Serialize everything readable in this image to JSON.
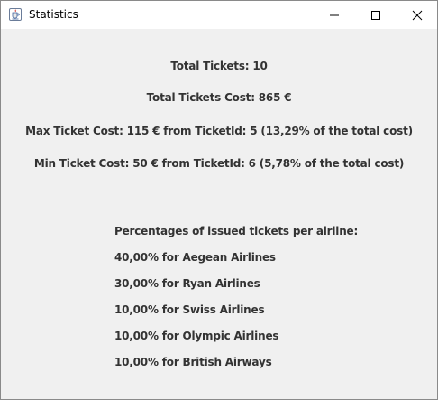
{
  "window": {
    "title": "Statistics",
    "app_icon": "java-cup-icon"
  },
  "stats": {
    "total_tickets": "Total Tickets: 10",
    "total_cost": "Total Tickets Cost: 865 €",
    "max_cost": "Max Ticket Cost: 115 € from TicketId: 5 (13,29% of the total cost)",
    "min_cost": "Min Ticket Cost: 50 € from TicketId: 6 (5,78% of the total cost)"
  },
  "airlines": {
    "heading": "Percentages of issued tickets per airline:",
    "items": [
      "40,00% for Aegean Airlines",
      "30,00% for Ryan Airlines",
      "10,00% for Swiss Airlines",
      "10,00% for Olympic Airlines",
      "10,00% for British Airways"
    ]
  }
}
